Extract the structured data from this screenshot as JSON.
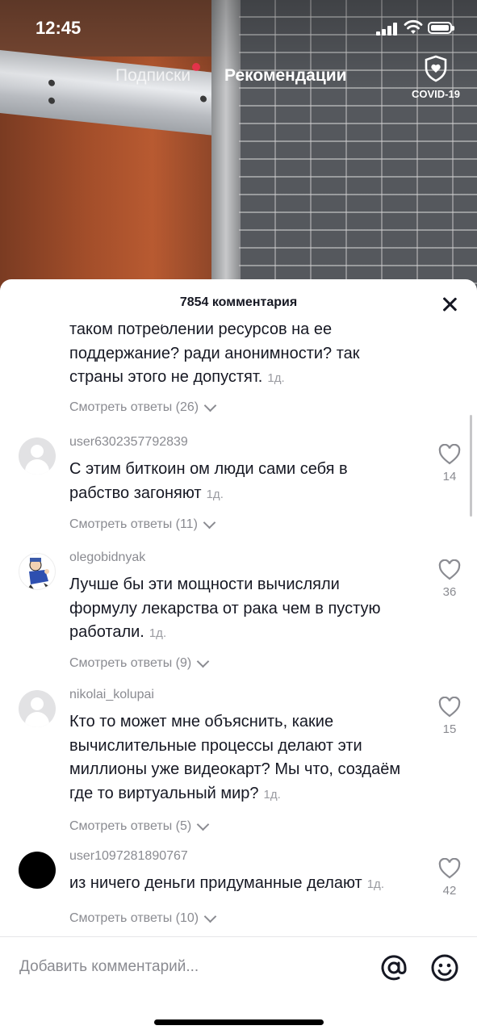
{
  "status_bar": {
    "time": "12:45"
  },
  "top_tabs": {
    "following": "Подписки",
    "for_you": "Рекомендации"
  },
  "covid_badge": {
    "label": "COVID-19"
  },
  "comments_panel": {
    "count_label": "7854 комментария",
    "partial_comment": {
      "text": "таком потреблении ресурсов на ее поддержание? ради анонимности? так страны этого не допустят.",
      "age": "1д.",
      "replies": "Смотреть ответы (26)"
    },
    "comments": [
      {
        "username": "user6302357792839",
        "avatar": "default-avatar",
        "text": "С этим биткоин ом люди сами себя в рабство загоняют",
        "age": "1д.",
        "likes": "14",
        "replies": "Смотреть ответы (11)"
      },
      {
        "username": "olegobidnyak",
        "avatar": "cartoon-avatar",
        "text": "Лучше бы эти мощности вычисляли формулу лекарства от рака чем в пустую работали.",
        "age": "1д.",
        "likes": "36",
        "replies": "Смотреть ответы (9)"
      },
      {
        "username": "nikolai_kolupai",
        "avatar": "default-avatar",
        "text": "Кто то может мне объяснить, какие вычислительные процессы делают эти миллионы уже видеокарт? Мы что, создаём где то виртуальный мир?",
        "age": "1д.",
        "likes": "15",
        "replies": "Смотреть ответы (5)"
      },
      {
        "username": "user1097281890767",
        "avatar": "black-avatar",
        "text": "из ничего деньги придуманные делают",
        "age": "1д.",
        "likes": "42",
        "replies": "Смотреть ответы (10)"
      }
    ]
  },
  "input_bar": {
    "placeholder": "Добавить комментарий..."
  },
  "icons": [
    "signal-icon",
    "wifi-icon",
    "battery-icon",
    "covid-shield-icon",
    "close-icon",
    "heart-icon",
    "chevron-down-icon",
    "at-icon",
    "emoji-icon"
  ],
  "colors": {
    "accent": "#fe2c55",
    "text": "#161823",
    "secondary": "#8a8b91"
  }
}
